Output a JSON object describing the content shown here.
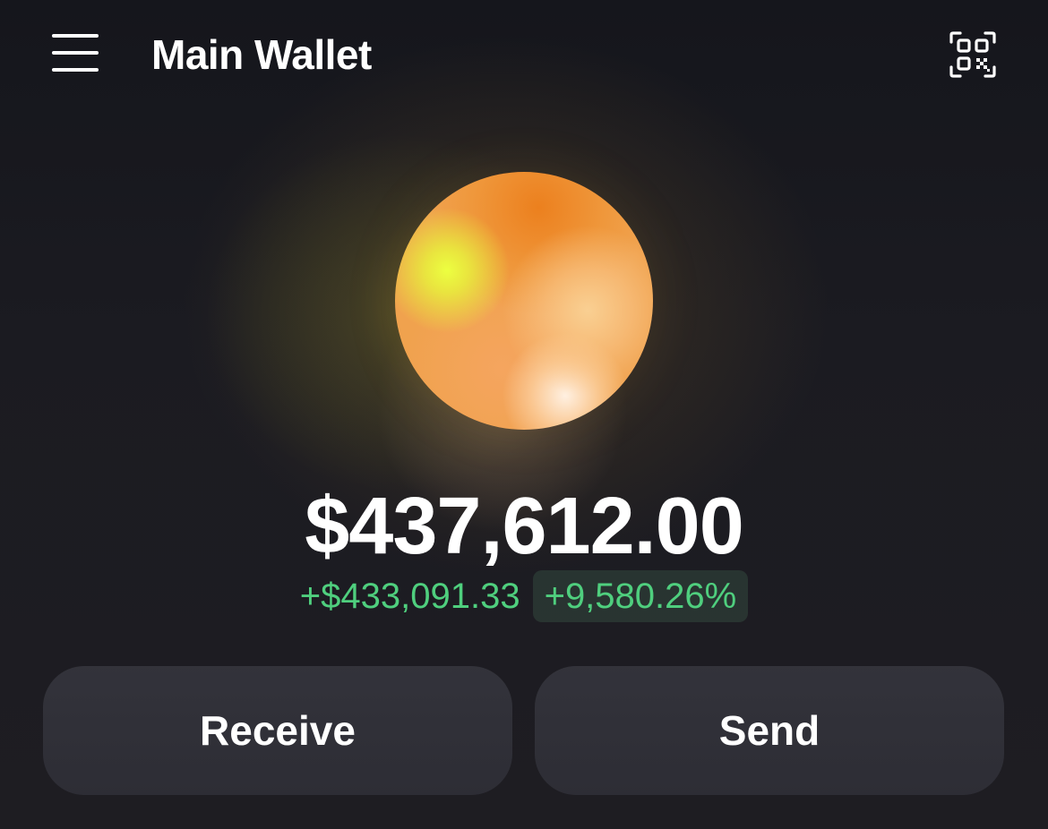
{
  "header": {
    "title": "Main Wallet",
    "menu_icon": "hamburger-menu-icon",
    "qr_icon": "qr-code-scan-icon"
  },
  "wallet": {
    "balance": "$437,612.00",
    "change_amount": "+$433,091.33",
    "change_percent": "+9,580.26%",
    "positive_color": "#4fcf7e"
  },
  "actions": {
    "receive_label": "Receive",
    "send_label": "Send"
  }
}
